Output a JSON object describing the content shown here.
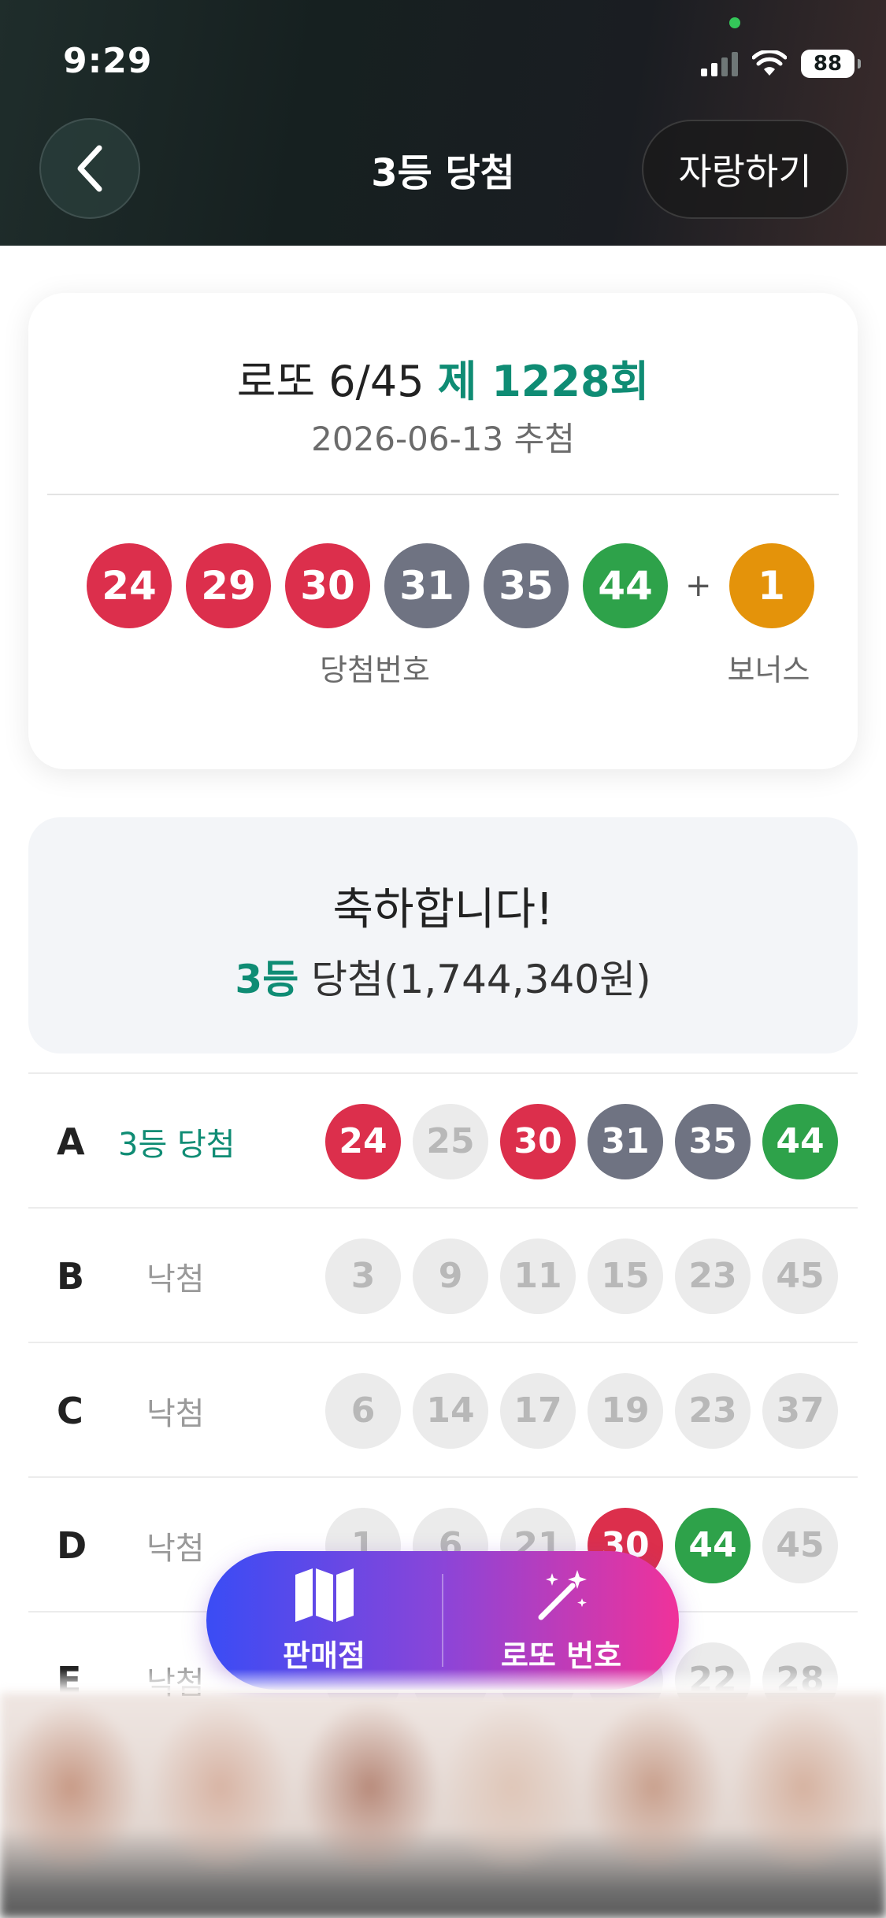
{
  "status_bar": {
    "time": "9:29",
    "battery": "88"
  },
  "header": {
    "title": "3등 당첨",
    "share_label": "자랑하기",
    "back_icon": "chevron-left-icon"
  },
  "draw": {
    "title_prefix": "로또 6/45",
    "round_label": "제 1228회",
    "date": "2026-06-13 추첨",
    "winning_numbers": [
      {
        "num": "24",
        "color": "#dc2f4c"
      },
      {
        "num": "29",
        "color": "#dc2f4c"
      },
      {
        "num": "30",
        "color": "#dc2f4c"
      },
      {
        "num": "31",
        "color": "#6f7382"
      },
      {
        "num": "35",
        "color": "#6f7382"
      },
      {
        "num": "44",
        "color": "#2ea24a"
      }
    ],
    "plus": "+",
    "bonus_number": {
      "num": "1",
      "color": "#e4930a"
    },
    "winning_caption": "당첨번호",
    "bonus_caption": "보너스"
  },
  "result": {
    "congrats": "축하합니다!",
    "rank": "3등",
    "prize_text": " 당첨(1,744,340원)"
  },
  "tickets": [
    {
      "letter": "A",
      "status": "3등 당첨",
      "win": true,
      "numbers": [
        {
          "num": "24",
          "color": "#dc2f4c"
        },
        {
          "num": "25",
          "color": "gray"
        },
        {
          "num": "30",
          "color": "#dc2f4c"
        },
        {
          "num": "31",
          "color": "#6f7382"
        },
        {
          "num": "35",
          "color": "#6f7382"
        },
        {
          "num": "44",
          "color": "#2ea24a"
        }
      ]
    },
    {
      "letter": "B",
      "status": "낙첨",
      "win": false,
      "numbers": [
        {
          "num": "3",
          "color": "gray"
        },
        {
          "num": "9",
          "color": "gray"
        },
        {
          "num": "11",
          "color": "gray"
        },
        {
          "num": "15",
          "color": "gray"
        },
        {
          "num": "23",
          "color": "gray"
        },
        {
          "num": "45",
          "color": "gray"
        }
      ]
    },
    {
      "letter": "C",
      "status": "낙첨",
      "win": false,
      "numbers": [
        {
          "num": "6",
          "color": "gray"
        },
        {
          "num": "14",
          "color": "gray"
        },
        {
          "num": "17",
          "color": "gray"
        },
        {
          "num": "19",
          "color": "gray"
        },
        {
          "num": "23",
          "color": "gray"
        },
        {
          "num": "37",
          "color": "gray"
        }
      ]
    },
    {
      "letter": "D",
      "status": "낙첨",
      "win": false,
      "numbers": [
        {
          "num": "1",
          "color": "gray"
        },
        {
          "num": "6",
          "color": "gray"
        },
        {
          "num": "21",
          "color": "gray"
        },
        {
          "num": "30",
          "color": "#dc2f4c"
        },
        {
          "num": "44",
          "color": "#2ea24a"
        },
        {
          "num": "45",
          "color": "gray"
        }
      ]
    },
    {
      "letter": "E",
      "status": "낙첨",
      "win": false,
      "numbers": [
        {
          "num": "",
          "color": "gray"
        },
        {
          "num": "",
          "color": "gray"
        },
        {
          "num": "",
          "color": "gray"
        },
        {
          "num": "",
          "color": "gray"
        },
        {
          "num": "22",
          "color": "gray"
        },
        {
          "num": "28",
          "color": "gray"
        }
      ]
    }
  ],
  "fab": {
    "store_label": "판매점",
    "store_icon": "map-icon",
    "lotto_label": "로또 번호",
    "lotto_icon": "magic-wand-icon"
  },
  "colors": {
    "accent": "#0f8c74",
    "red_ball": "#dc2f4c",
    "gray_ball": "#6f7382",
    "green_ball": "#2ea24a",
    "bonus_ball": "#e4930a"
  }
}
